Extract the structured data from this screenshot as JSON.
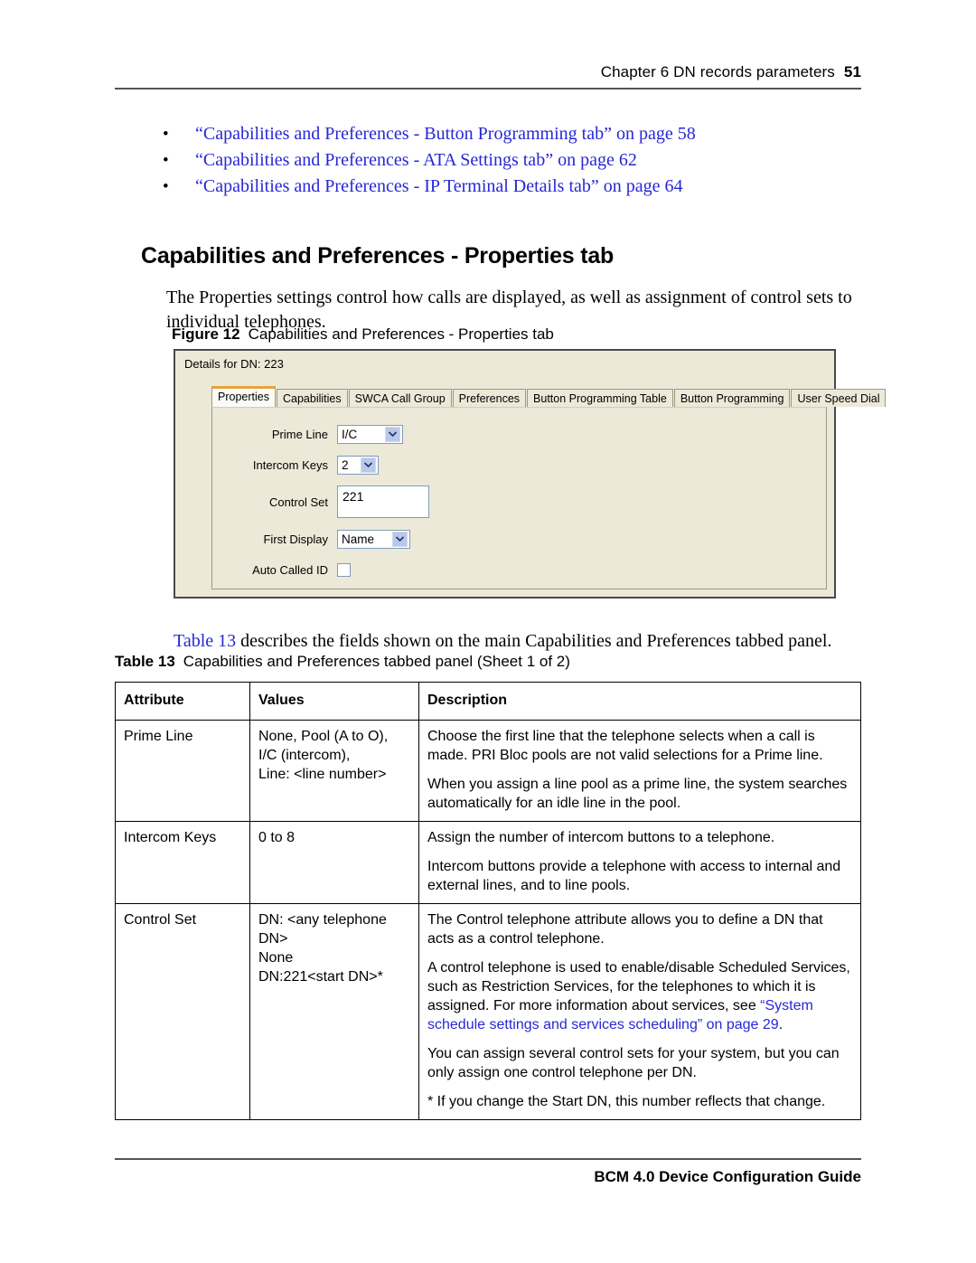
{
  "header": {
    "chapter": "Chapter 6  DN records parameters",
    "page_number": "51"
  },
  "xref_bullets": {
    "bullet_glyph": "•",
    "items": [
      {
        "text": "“Capabilities and Preferences - Button Programming tab” on page 58"
      },
      {
        "text": "“Capabilities and Preferences - ATA Settings tab” on page 62"
      },
      {
        "text": "“Capabilities and Preferences - IP Terminal Details tab” on page 64"
      }
    ]
  },
  "section": {
    "heading": "Capabilities and Preferences - Properties tab",
    "intro": "The Properties settings control how calls are displayed, as well as assignment of control sets to individual telephones."
  },
  "figure": {
    "caption_label": "Figure 12",
    "caption_text": "Capabilities and Preferences - Properties tab",
    "dialog_title": "Details for DN: 223",
    "tabs": [
      {
        "label": "Properties",
        "active": true
      },
      {
        "label": "Capabilities",
        "active": false
      },
      {
        "label": "SWCA Call Group",
        "active": false
      },
      {
        "label": "Preferences",
        "active": false
      },
      {
        "label": "Button Programming Table",
        "active": false
      },
      {
        "label": "Button Programming",
        "active": false
      },
      {
        "label": "User Speed Dial",
        "active": false
      }
    ],
    "fields": {
      "prime_line": {
        "label": "Prime Line",
        "value": "I/C"
      },
      "intercom_keys": {
        "label": "Intercom Keys",
        "value": "2"
      },
      "control_set": {
        "label": "Control Set",
        "value": "221"
      },
      "first_display": {
        "label": "First Display",
        "value": "Name"
      },
      "auto_called_id": {
        "label": "Auto Called ID",
        "checked": false
      }
    },
    "colors": {
      "dialog_background": "#ece9d8",
      "active_tab_accent": "#e8a33d",
      "control_border": "#7f9db9",
      "dropdown_button": "#b9c8e8"
    }
  },
  "table_intro": {
    "link_text": "Table 13",
    "rest_text": " describes the fields shown on the main Capabilities and Preferences tabbed panel."
  },
  "table": {
    "caption_label": "Table 13",
    "caption_text": "Capabilities and Preferences tabbed panel (Sheet 1 of 2)",
    "headers": [
      "Attribute",
      "Values",
      "Description"
    ],
    "rows": [
      {
        "attribute": "Prime Line",
        "values": [
          "None, Pool (A to O),",
          "I/C (intercom),",
          "Line: <line number>"
        ],
        "description": [
          {
            "text": "Choose the first line that the telephone selects when a call is made. PRI Bloc pools are not valid selections for a Prime line."
          },
          {
            "text": "When you assign a line pool as a prime line, the system searches automatically for an idle line in the pool."
          }
        ]
      },
      {
        "attribute": "Intercom Keys",
        "values": [
          "0 to 8"
        ],
        "description": [
          {
            "text": "Assign the number of intercom buttons to a telephone."
          },
          {
            "text": "Intercom buttons provide a telephone with access to internal and external lines, and to line pools."
          }
        ]
      },
      {
        "attribute": "Control Set",
        "values": [
          "DN: <any telephone DN>",
          "None",
          "DN:221<start DN>*"
        ],
        "description": [
          {
            "text": "The Control telephone attribute allows you to define a DN that acts as a control telephone."
          },
          {
            "pre": "A control telephone is used to enable/disable Scheduled Services, such as Restriction Services, for the telephones to which it is assigned. For more information about services, see ",
            "link": "“System schedule settings and services scheduling” on page 29",
            "post": "."
          },
          {
            "text": "You can assign several control sets for your system, but you can only assign one control telephone per DN."
          },
          {
            "text": "* If you change the Start DN, this number reflects that change."
          }
        ]
      }
    ]
  },
  "footer": {
    "text": "BCM 4.0 Device Configuration Guide"
  }
}
